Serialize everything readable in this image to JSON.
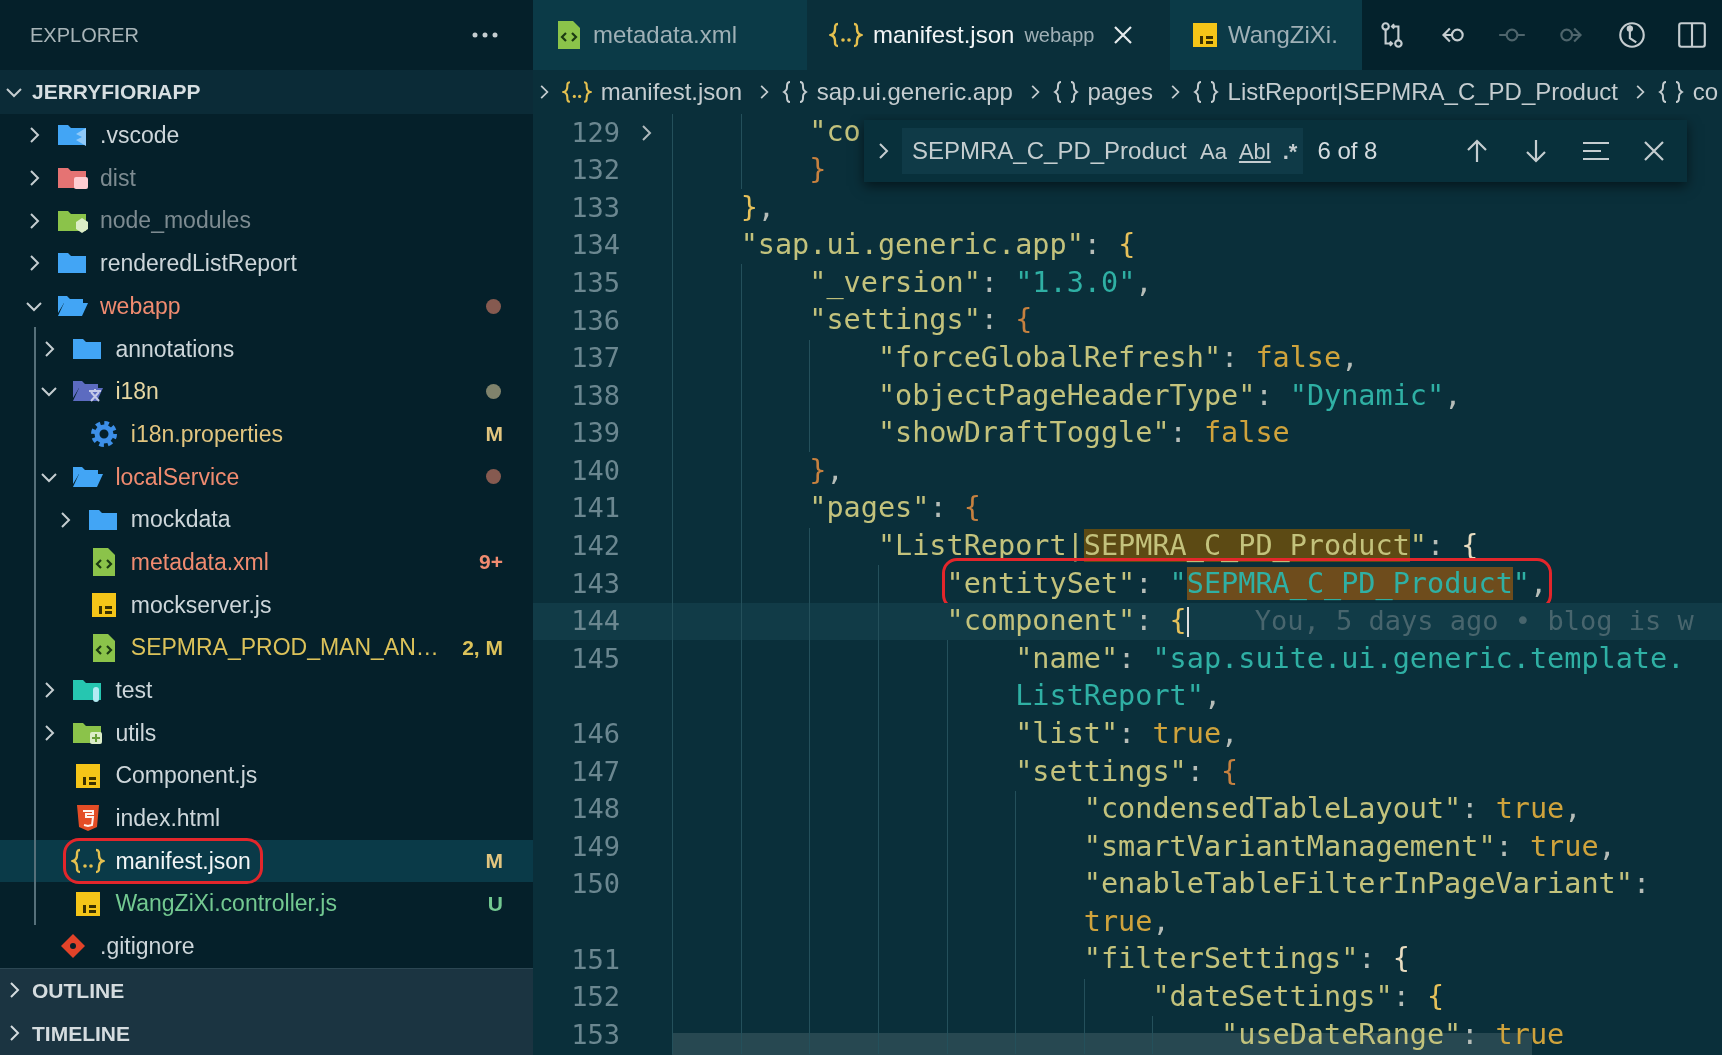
{
  "explorer": {
    "title": "EXPLORER",
    "root": {
      "label": "JERRYFIORIAPP",
      "expanded": true
    },
    "tree": [
      {
        "label": ".vscode",
        "kind": "vscode",
        "expanded": false,
        "selected": false
      },
      {
        "label": "dist",
        "kind": "dist",
        "color": "#7d8b91",
        "expanded": false,
        "selected": false
      },
      {
        "label": "node_modules",
        "kind": "node",
        "color": "#7d8b91",
        "expanded": false,
        "selected": false
      },
      {
        "label": "renderedListReport",
        "kind": "folder",
        "expanded": false,
        "selected": false
      },
      {
        "label": "webapp",
        "kind": "folder",
        "color": "#f08b70",
        "dot": true,
        "expanded": true,
        "selected": false,
        "children": [
          {
            "label": "annotations",
            "kind": "folder",
            "expanded": false,
            "selected": false
          },
          {
            "label": "i18n",
            "kind": "i18n",
            "color": "#e6d6a2",
            "dot": true,
            "expanded": true,
            "selected": false,
            "children": [
              {
                "label": "i18n.properties",
                "kind": "settings",
                "color": "#e2c57f",
                "badge": "M",
                "selected": false
              }
            ]
          },
          {
            "label": "localService",
            "kind": "folder",
            "color": "#f08b70",
            "dot": true,
            "expanded": true,
            "selected": false,
            "children": [
              {
                "label": "mockdata",
                "kind": "folder",
                "expanded": false,
                "selected": false
              },
              {
                "label": "metadata.xml",
                "kind": "xml",
                "color": "#f08b70",
                "badge": "9+",
                "selected": false
              },
              {
                "label": "mockserver.js",
                "kind": "js",
                "selected": false
              },
              {
                "label": "SEPMRA_PROD_MAN_AN…",
                "kind": "xml",
                "color": "#dcc25a",
                "badge": "2, M",
                "selected": false
              }
            ]
          },
          {
            "label": "test",
            "kind": "test",
            "expanded": false,
            "selected": false
          },
          {
            "label": "utils",
            "kind": "utils",
            "expanded": false,
            "selected": false
          },
          {
            "label": "Component.js",
            "kind": "js",
            "selected": false
          },
          {
            "label": "index.html",
            "kind": "html",
            "selected": false
          },
          {
            "label": "manifest.json",
            "kind": "json",
            "color": "#e2c57f",
            "badge": "M",
            "selected": true,
            "circled": true
          },
          {
            "label": "WangZiXi.controller.js",
            "kind": "js",
            "color": "#73c991",
            "badge": "U",
            "selected": false
          }
        ]
      },
      {
        "label": ".gitignore",
        "kind": "git",
        "selected": false
      }
    ],
    "panels": [
      {
        "label": "OUTLINE",
        "expanded": false
      },
      {
        "label": "TIMELINE",
        "expanded": false
      }
    ]
  },
  "tabs": [
    {
      "label": "metadata.xml",
      "kind": "xml",
      "selected": false
    },
    {
      "label": "manifest.json",
      "description": "webapp",
      "kind": "json",
      "selected": true
    },
    {
      "label": "WangZiXi.",
      "kind": "js",
      "selected": false
    }
  ],
  "toolbar": [
    {
      "kind": "compare",
      "disabled": false
    },
    {
      "kind": "back",
      "disabled": false
    },
    {
      "kind": "commit",
      "disabled": true
    },
    {
      "kind": "forward",
      "disabled": true
    },
    {
      "kind": "history",
      "disabled": false
    },
    {
      "kind": "split",
      "disabled": false
    }
  ],
  "breadcrumbs": [
    {
      "kind": "file",
      "label": "manifest.json"
    },
    {
      "kind": "object",
      "label": "sap.ui.generic.app"
    },
    {
      "kind": "object",
      "label": "pages"
    },
    {
      "kind": "object",
      "label": "ListReport|SEPMRA_C_PD_Product"
    },
    {
      "kind": "object",
      "label": "co"
    }
  ],
  "find": {
    "value": "SEPMRA_C_PD_Product",
    "options": [
      {
        "kind": "case",
        "label": "Aa",
        "on": false
      },
      {
        "kind": "word",
        "label": "Abl",
        "on": false
      },
      {
        "kind": "regex",
        "label": ".*",
        "on": false
      }
    ],
    "count": "6 of 8"
  },
  "editor": {
    "lines": [
      {
        "number": "129",
        "folded": true,
        "tokens": [
          {
            "kind": "key",
            "text": "        \"co"
          }
        ]
      },
      {
        "number": "132",
        "tokens": [
          {
            "kind": "brace2",
            "text": "        }"
          }
        ]
      },
      {
        "number": "133",
        "tokens": [
          {
            "kind": "brace",
            "text": "    }"
          },
          {
            "kind": "punct",
            "text": ","
          }
        ]
      },
      {
        "number": "134",
        "tokens": [
          {
            "kind": "key",
            "text": "    \"sap.ui.generic.app\""
          },
          {
            "kind": "punct",
            "text": ": "
          },
          {
            "kind": "brace",
            "text": "{"
          }
        ]
      },
      {
        "number": "135",
        "tokens": [
          {
            "kind": "key",
            "text": "        \"_version\""
          },
          {
            "kind": "punct",
            "text": ": "
          },
          {
            "kind": "value",
            "text": "\"1.3.0\""
          },
          {
            "kind": "punct",
            "text": ","
          }
        ]
      },
      {
        "number": "136",
        "tokens": [
          {
            "kind": "key",
            "text": "        \"settings\""
          },
          {
            "kind": "punct",
            "text": ": "
          },
          {
            "kind": "brace2",
            "text": "{"
          }
        ]
      },
      {
        "number": "137",
        "tokens": [
          {
            "kind": "key",
            "text": "            \"forceGlobalRefresh\""
          },
          {
            "kind": "punct",
            "text": ": "
          },
          {
            "kind": "literal",
            "text": "false"
          },
          {
            "kind": "punct",
            "text": ","
          }
        ]
      },
      {
        "number": "138",
        "tokens": [
          {
            "kind": "key",
            "text": "            \"objectPageHeaderType\""
          },
          {
            "kind": "punct",
            "text": ": "
          },
          {
            "kind": "value",
            "text": "\"Dynamic\""
          },
          {
            "kind": "punct",
            "text": ","
          }
        ]
      },
      {
        "number": "139",
        "tokens": [
          {
            "kind": "key",
            "text": "            \"showDraftToggle\""
          },
          {
            "kind": "punct",
            "text": ": "
          },
          {
            "kind": "literal",
            "text": "false"
          }
        ]
      },
      {
        "number": "140",
        "tokens": [
          {
            "kind": "brace2",
            "text": "        }"
          },
          {
            "kind": "punct",
            "text": ","
          }
        ]
      },
      {
        "number": "141",
        "tokens": [
          {
            "kind": "key",
            "text": "        \"pages\""
          },
          {
            "kind": "punct",
            "text": ": "
          },
          {
            "kind": "brace2",
            "text": "{"
          }
        ]
      },
      {
        "number": "142",
        "tokens": [
          {
            "kind": "key",
            "text": "            \"ListReport|"
          },
          {
            "kind": "key",
            "text": "SEPMRA_C_PD_Product",
            "match": true,
            "current": false
          },
          {
            "kind": "key",
            "text": "\""
          },
          {
            "kind": "punct",
            "text": ": "
          },
          {
            "kind": "brace3",
            "text": "{"
          }
        ]
      },
      {
        "number": "143",
        "circled": true,
        "tokens": [
          {
            "kind": "key",
            "text": "                \"entitySet\""
          },
          {
            "kind": "punct",
            "text": ": "
          },
          {
            "kind": "value",
            "text": "\""
          },
          {
            "kind": "value",
            "text": "SEPMRA_C_PD_Product",
            "match": true,
            "current": true
          },
          {
            "kind": "value",
            "text": "\""
          },
          {
            "kind": "punct",
            "text": ","
          }
        ]
      },
      {
        "number": "144",
        "current": true,
        "blame": "You, 5 days ago • blog is w",
        "tokens": [
          {
            "kind": "key",
            "text": "                \"component\""
          },
          {
            "kind": "punct",
            "text": ": "
          },
          {
            "kind": "brace",
            "text": "{"
          }
        ]
      },
      {
        "number": "145",
        "tokens": [
          {
            "kind": "key",
            "text": "                    \"name\""
          },
          {
            "kind": "punct",
            "text": ": "
          },
          {
            "kind": "value",
            "text": "\"sap.suite.ui.generic.template."
          }
        ]
      },
      {
        "tokens": [
          {
            "kind": "value",
            "text": "                    ListReport\""
          },
          {
            "kind": "punct",
            "text": ","
          }
        ]
      },
      {
        "number": "146",
        "tokens": [
          {
            "kind": "key",
            "text": "                    \"list\""
          },
          {
            "kind": "punct",
            "text": ": "
          },
          {
            "kind": "literal",
            "text": "true"
          },
          {
            "kind": "punct",
            "text": ","
          }
        ]
      },
      {
        "number": "147",
        "tokens": [
          {
            "kind": "key",
            "text": "                    \"settings\""
          },
          {
            "kind": "punct",
            "text": ": "
          },
          {
            "kind": "brace2",
            "text": "{"
          }
        ]
      },
      {
        "number": "148",
        "tokens": [
          {
            "kind": "key",
            "text": "                        \"condensedTableLayout\""
          },
          {
            "kind": "punct",
            "text": ": "
          },
          {
            "kind": "literal",
            "text": "true"
          },
          {
            "kind": "punct",
            "text": ","
          }
        ]
      },
      {
        "number": "149",
        "tokens": [
          {
            "kind": "key",
            "text": "                        \"smartVariantManagement\""
          },
          {
            "kind": "punct",
            "text": ": "
          },
          {
            "kind": "literal",
            "text": "true"
          },
          {
            "kind": "punct",
            "text": ","
          }
        ]
      },
      {
        "number": "150",
        "tokens": [
          {
            "kind": "key",
            "text": "                        \"enableTableFilterInPageVariant\""
          },
          {
            "kind": "punct",
            "text": ":"
          }
        ]
      },
      {
        "tokens": [
          {
            "kind": "literal",
            "text": "                        true"
          },
          {
            "kind": "punct",
            "text": ","
          }
        ]
      },
      {
        "number": "151",
        "tokens": [
          {
            "kind": "key",
            "text": "                        \"filterSettings\""
          },
          {
            "kind": "punct",
            "text": ": "
          },
          {
            "kind": "brace3",
            "text": "{"
          }
        ]
      },
      {
        "number": "152",
        "tokens": [
          {
            "kind": "key",
            "text": "                            \"dateSettings\""
          },
          {
            "kind": "punct",
            "text": ": "
          },
          {
            "kind": "brace",
            "text": "{"
          }
        ]
      },
      {
        "number": "153",
        "tokens": [
          {
            "kind": "key",
            "text": "                                \"useDateRange\""
          },
          {
            "kind": "punct",
            "text": ": "
          },
          {
            "kind": "literal",
            "text": "true"
          }
        ]
      }
    ]
  }
}
